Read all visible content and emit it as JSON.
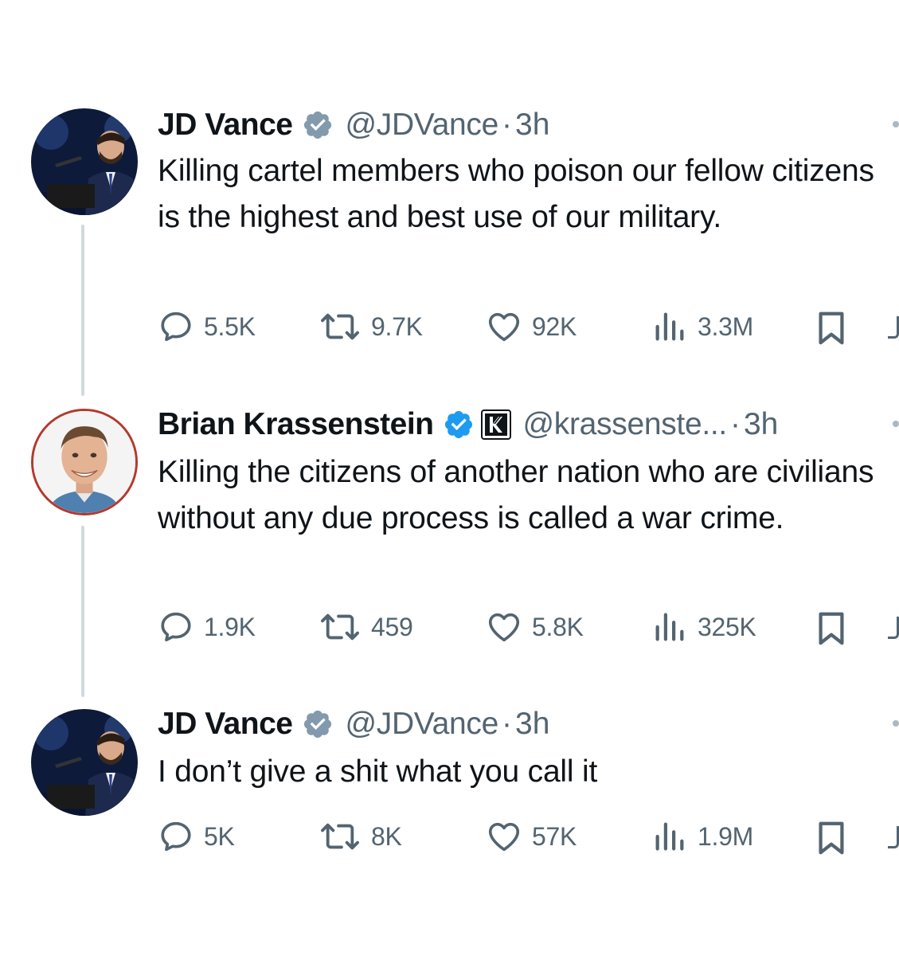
{
  "tweets": [
    {
      "name": "JD Vance",
      "handle": "@JDVance",
      "dot": "·",
      "time": "3h",
      "text": "Killing cartel members who poison our fellow citizens is the highest and best use of our military.",
      "replies": "5.5K",
      "retweets": "9.7K",
      "likes": "92K",
      "views": "3.3M"
    },
    {
      "name": "Brian Krassenstein",
      "handle": "@krassenste...",
      "dot": "·",
      "time": "3h",
      "text": "Killing the citizens of another nation who are civilians without any due process is called a war crime.",
      "replies": "1.9K",
      "retweets": "459",
      "likes": "5.8K",
      "views": "325K"
    },
    {
      "name": "JD Vance",
      "handle": "@JDVance",
      "dot": "·",
      "time": "3h",
      "text": "I don’t give a shit what you call it",
      "replies": "5K",
      "retweets": "8K",
      "likes": "57K",
      "views": "1.9M"
    }
  ],
  "colors": {
    "text": "#0f1419",
    "muted": "#536471",
    "thread_line": "#cfd9de",
    "gov_badge": "#829aab",
    "blue_badge": "#1d9bf0"
  },
  "icons": [
    "reply-icon",
    "retweet-icon",
    "like-icon",
    "views-icon",
    "bookmark-icon",
    "share-icon"
  ]
}
